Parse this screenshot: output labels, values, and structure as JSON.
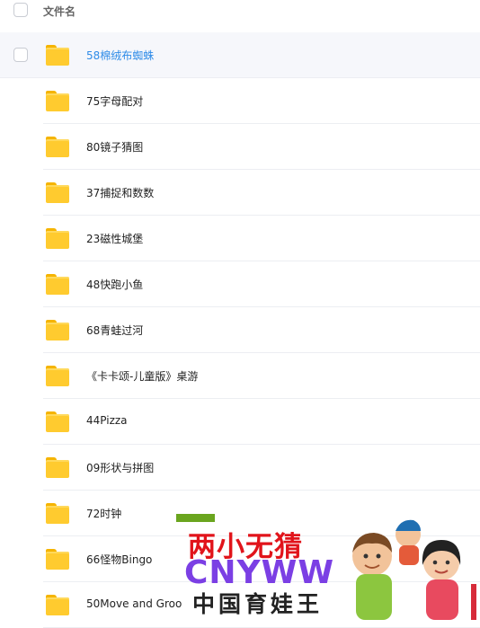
{
  "header": {
    "column_label": "文件名"
  },
  "files": [
    {
      "name": "58棉绒布蜘蛛",
      "selected": true
    },
    {
      "name": "75字母配对"
    },
    {
      "name": "80镜子猜图"
    },
    {
      "name": "37捕捉和数数"
    },
    {
      "name": "23磁性城堡"
    },
    {
      "name": "48快跑小鱼"
    },
    {
      "name": "68青蛙过河"
    },
    {
      "name": "《卡卡颂-儿童版》桌游"
    },
    {
      "name": "44Pizza"
    },
    {
      "name": "09形状与拼图"
    },
    {
      "name": "72时钟"
    },
    {
      "name": "66怪物Bingo"
    },
    {
      "name": "50Move and Groo"
    }
  ],
  "icons": {
    "folder": "folder-icon"
  },
  "colors": {
    "folder": "#ffcb2f",
    "selected_text": "#2f8ce8",
    "selected_bg": "#f6f7fb"
  },
  "watermark": {
    "line1": "两小无猜",
    "line2": "CNYWW",
    "line3": "中国育娃王"
  }
}
